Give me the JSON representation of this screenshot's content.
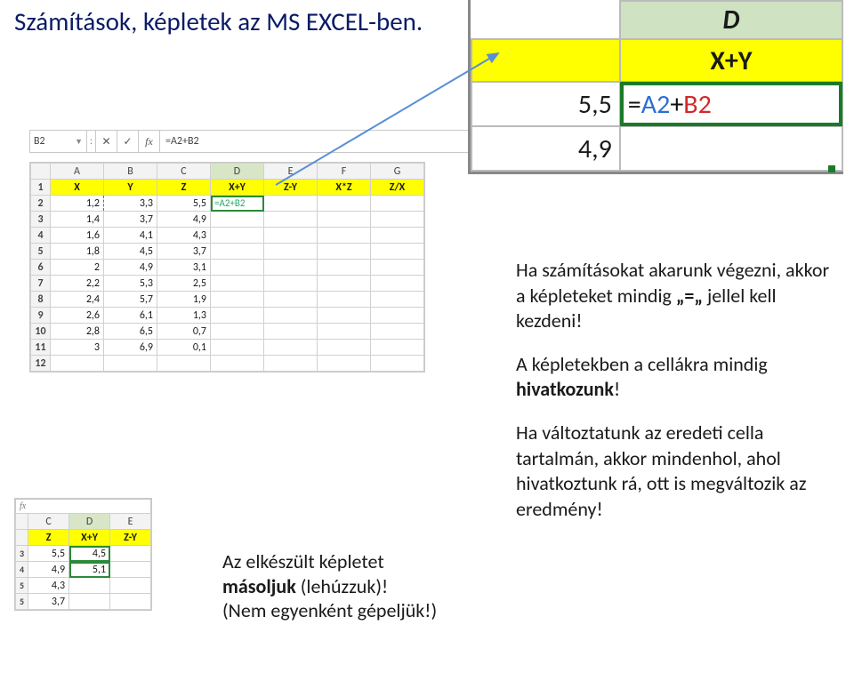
{
  "title": "Számítások, képletek az MS EXCEL-ben.",
  "fbar": {
    "cellref": "B2",
    "formula": "=A2+B2",
    "fx": "fx"
  },
  "grid": {
    "cols": [
      "A",
      "B",
      "C",
      "D",
      "E",
      "F",
      "G"
    ],
    "headers": [
      "X",
      "Y",
      "Z",
      "X+Y",
      "Z-Y",
      "X*Z",
      "Z/X"
    ],
    "rows": [
      {
        "n": "2",
        "v": [
          "1,2",
          "3,3",
          "5,5",
          "=A2+B2",
          "",
          "",
          ""
        ]
      },
      {
        "n": "3",
        "v": [
          "1,4",
          "3,7",
          "4,9",
          "",
          "",
          "",
          ""
        ]
      },
      {
        "n": "4",
        "v": [
          "1,6",
          "4,1",
          "4,3",
          "",
          "",
          "",
          ""
        ]
      },
      {
        "n": "5",
        "v": [
          "1,8",
          "4,5",
          "3,7",
          "",
          "",
          "",
          ""
        ]
      },
      {
        "n": "6",
        "v": [
          "2",
          "4,9",
          "3,1",
          "",
          "",
          "",
          ""
        ]
      },
      {
        "n": "7",
        "v": [
          "2,2",
          "5,3",
          "2,5",
          "",
          "",
          "",
          ""
        ]
      },
      {
        "n": "8",
        "v": [
          "2,4",
          "5,7",
          "1,9",
          "",
          "",
          "",
          ""
        ]
      },
      {
        "n": "9",
        "v": [
          "2,6",
          "6,1",
          "1,3",
          "",
          "",
          "",
          ""
        ]
      },
      {
        "n": "10",
        "v": [
          "2,8",
          "6,5",
          "0,7",
          "",
          "",
          "",
          ""
        ]
      },
      {
        "n": "11",
        "v": [
          "3",
          "6,9",
          "0,1",
          "",
          "",
          "",
          ""
        ]
      },
      {
        "n": "12",
        "v": [
          "",
          "",
          "",
          "",
          "",
          "",
          ""
        ]
      }
    ]
  },
  "zoom": {
    "colLabel": "D",
    "header": "X+Y",
    "row2_left": "5,5",
    "row2_formula": {
      "eq": "=",
      "a": "A2",
      "plus": "+",
      "b": "B2"
    },
    "row3_left": "4,9"
  },
  "grid2": {
    "cols": [
      "C",
      "D",
      "E"
    ],
    "headers": [
      "Z",
      "X+Y",
      "Z-Y"
    ],
    "rows": [
      {
        "n": "3",
        "v": [
          "5,5",
          "4,5",
          ""
        ]
      },
      {
        "n": "4",
        "v": [
          "4,9",
          "5,1",
          ""
        ]
      },
      {
        "n": "5",
        "v": [
          "4,3",
          "",
          ""
        ]
      },
      {
        "n": "5",
        "v": [
          "3,7",
          "",
          ""
        ]
      }
    ],
    "fx": "fx"
  },
  "note1": {
    "l1": "Az elkészült képletet",
    "l2a": "másoljuk",
    "l2b": " (lehúzzuk)!",
    "l3": "(Nem egyenként gépeljük!)"
  },
  "right": {
    "p1a": "Ha számításokat akarunk végezni, akkor a képleteket mindig ",
    "p1b": "„=„",
    "p1c": " jellel kell kezdeni!",
    "p2a": "A képletekben a cellákra mindig ",
    "p2b": "hivatkozunk",
    "p2c": "!",
    "p3": "Ha változtatunk az eredeti cella tartalmán, akkor mindenhol, ahol hivatkoztunk rá, ott is megváltozik az eredmény!"
  }
}
